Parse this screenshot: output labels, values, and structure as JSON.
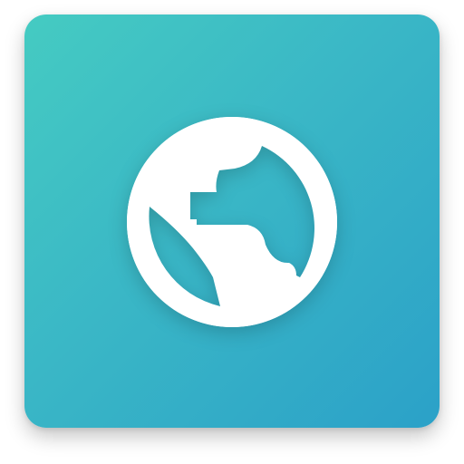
{
  "app_icon": {
    "glyph": "globe-icon",
    "colors": {
      "gradient_start": "#45CBC2",
      "gradient_mid": "#3AB7C6",
      "gradient_end": "#2BA1C8",
      "glyph": "#FFFFFF"
    }
  }
}
